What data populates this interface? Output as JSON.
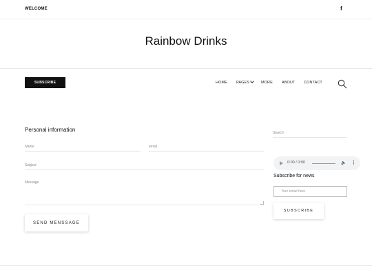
{
  "topbar": {
    "welcome": "WELCOME",
    "facebook_icon": "facebook-icon",
    "facebook_glyph": "f"
  },
  "header": {
    "site_title": "Rainbow Drinks"
  },
  "nav": {
    "subscribe_label": "SUBSCRIBE",
    "items": [
      {
        "label": "HOME"
      },
      {
        "label": "PAGES"
      },
      {
        "label": "MORE"
      },
      {
        "label": "ABOUT"
      },
      {
        "label": "CONTACT"
      }
    ],
    "search_icon": "search-icon"
  },
  "form": {
    "title": "Personal information",
    "name_placeholder": "Name",
    "email_placeholder": "email",
    "subject_placeholder": "Subject",
    "message_placeholder": "Message",
    "send_label": "SEND MENSSAGE"
  },
  "sidebar": {
    "search_placeholder": "Search",
    "audio": {
      "time": "0:00 / 0:00"
    },
    "news_title": "Subscribe for news",
    "email_placeholder": "Your email here",
    "subscribe_label": "SUBSCRIBE"
  }
}
